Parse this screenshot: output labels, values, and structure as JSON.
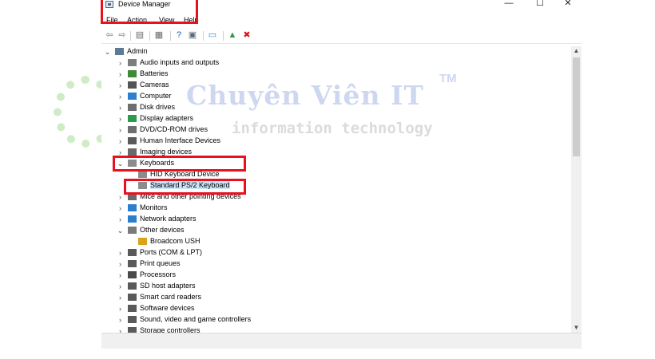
{
  "window": {
    "title": "Device Manager",
    "controls": {
      "minimize": "—",
      "maximize": "☐",
      "close": "✕"
    }
  },
  "menu": [
    "File",
    "Action",
    "View",
    "Help"
  ],
  "toolbar": [
    {
      "name": "back-arrow-icon",
      "glyph": "⇦",
      "color": "#7a7a7a"
    },
    {
      "name": "forward-arrow-icon",
      "glyph": "⇨",
      "color": "#7a7a7a"
    },
    {
      "name": "properties-view-icon",
      "glyph": "▤",
      "color": "#6b6b6b"
    },
    {
      "name": "device-list-icon",
      "glyph": "▦",
      "color": "#6b6b6b"
    },
    {
      "name": "help-icon",
      "glyph": "?",
      "color": "#1f5fbf"
    },
    {
      "name": "show-hidden-icon",
      "glyph": "▣",
      "color": "#5b6b7c"
    },
    {
      "name": "scan-hardware-icon",
      "glyph": "▭",
      "color": "#2a7fd0"
    },
    {
      "name": "update-driver-icon",
      "glyph": "▲",
      "color": "#2e9a3e"
    },
    {
      "name": "uninstall-device-icon",
      "glyph": "✖",
      "color": "#d9161b"
    }
  ],
  "tree": [
    {
      "label": "Admin",
      "level": 0,
      "expander": "expanded",
      "icon": "computer-icon",
      "color": "#5a7a96"
    },
    {
      "label": "Audio inputs and outputs",
      "level": 1,
      "expander": "collapsed",
      "icon": "speaker-icon",
      "color": "#7d7d7d"
    },
    {
      "label": "Batteries",
      "level": 1,
      "expander": "collapsed",
      "icon": "battery-icon",
      "color": "#3f8a3a"
    },
    {
      "label": "Cameras",
      "level": 1,
      "expander": "collapsed",
      "icon": "camera-icon",
      "color": "#555555"
    },
    {
      "label": "Computer",
      "level": 1,
      "expander": "collapsed",
      "icon": "computer-icon",
      "color": "#2c7fcf"
    },
    {
      "label": "Disk drives",
      "level": 1,
      "expander": "collapsed",
      "icon": "disk-drive-icon",
      "color": "#6f6f6f"
    },
    {
      "label": "Display adapters",
      "level": 1,
      "expander": "collapsed",
      "icon": "display-adapter-icon",
      "color": "#2c9a4a"
    },
    {
      "label": "DVD/CD-ROM drives",
      "level": 1,
      "expander": "collapsed",
      "icon": "dvd-drive-icon",
      "color": "#6f6f6f"
    },
    {
      "label": "Human Interface Devices",
      "level": 1,
      "expander": "collapsed",
      "icon": "hid-icon",
      "color": "#5a5a5a"
    },
    {
      "label": "Imaging devices",
      "level": 1,
      "expander": "collapsed",
      "icon": "imaging-icon",
      "color": "#6a6a6a"
    },
    {
      "label": "Keyboards",
      "level": 1,
      "expander": "expanded",
      "icon": "keyboard-icon",
      "color": "#8c8c8c"
    },
    {
      "label": "HID Keyboard Device",
      "level": 2,
      "expander": "none",
      "icon": "keyboard-icon",
      "color": "#8c8c8c"
    },
    {
      "label": "Standard PS/2 Keyboard",
      "level": 2,
      "expander": "none",
      "icon": "keyboard-icon",
      "color": "#8c8c8c",
      "selected": true
    },
    {
      "label": "Mice and other pointing devices",
      "level": 1,
      "expander": "collapsed",
      "icon": "mouse-icon",
      "color": "#6a6a6a"
    },
    {
      "label": "Monitors",
      "level": 1,
      "expander": "collapsed",
      "icon": "monitor-icon",
      "color": "#2c7fcf"
    },
    {
      "label": "Network adapters",
      "level": 1,
      "expander": "collapsed",
      "icon": "network-adapter-icon",
      "color": "#2c7fcf"
    },
    {
      "label": "Other devices",
      "level": 1,
      "expander": "expanded",
      "icon": "unknown-device-icon",
      "color": "#7a7a7a"
    },
    {
      "label": "Broadcom USH",
      "level": 2,
      "expander": "none",
      "icon": "warning-device-icon",
      "color": "#d9a21b"
    },
    {
      "label": "Ports (COM & LPT)",
      "level": 1,
      "expander": "collapsed",
      "icon": "port-icon",
      "color": "#5a5a5a"
    },
    {
      "label": "Print queues",
      "level": 1,
      "expander": "collapsed",
      "icon": "printer-icon",
      "color": "#5a5a5a"
    },
    {
      "label": "Processors",
      "level": 1,
      "expander": "collapsed",
      "icon": "processor-icon",
      "color": "#4a4a4a"
    },
    {
      "label": "SD host adapters",
      "level": 1,
      "expander": "collapsed",
      "icon": "sd-card-icon",
      "color": "#5a5a5a"
    },
    {
      "label": "Smart card readers",
      "level": 1,
      "expander": "collapsed",
      "icon": "smart-card-icon",
      "color": "#5a5a5a"
    },
    {
      "label": "Software devices",
      "level": 1,
      "expander": "collapsed",
      "icon": "software-device-icon",
      "color": "#5a5a5a"
    },
    {
      "label": "Sound, video and game controllers",
      "level": 1,
      "expander": "collapsed",
      "icon": "sound-icon",
      "color": "#5a5a5a"
    },
    {
      "label": "Storage controllers",
      "level": 1,
      "expander": "collapsed",
      "icon": "storage-controller-icon",
      "color": "#5a5a5a"
    }
  ],
  "watermark": {
    "brand": "Chuyên Viên IT",
    "trademark": "TM",
    "tagline": "information technology"
  },
  "highlight_color": "#e8111f"
}
